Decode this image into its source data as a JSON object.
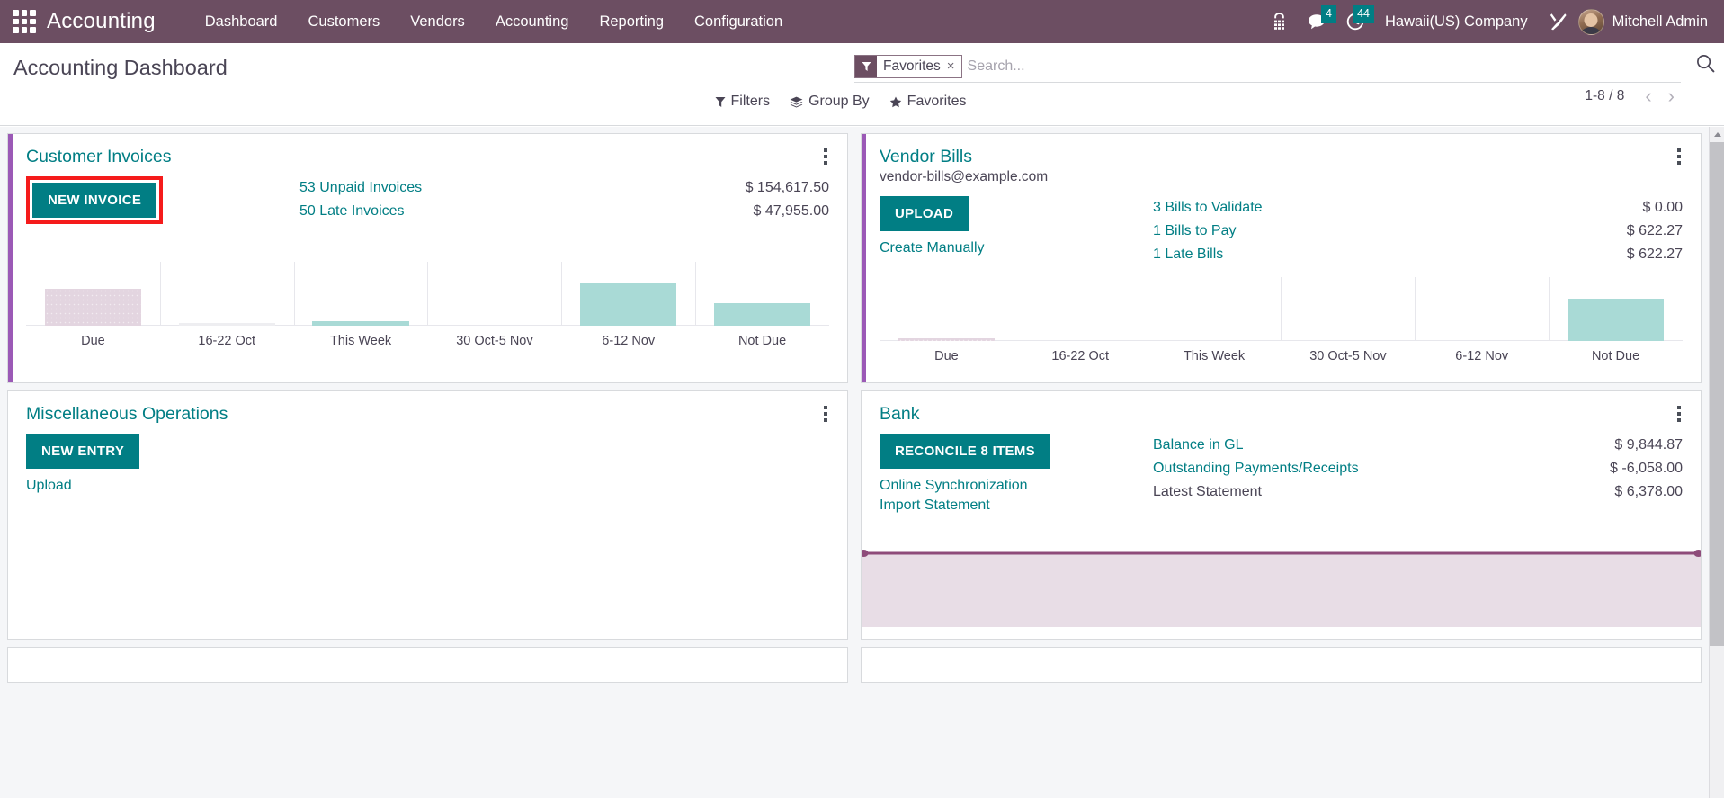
{
  "navbar": {
    "apps_icon": "apps-grid-icon",
    "brand": "Accounting",
    "menu": [
      {
        "label": "Dashboard"
      },
      {
        "label": "Customers"
      },
      {
        "label": "Vendors"
      },
      {
        "label": "Accounting"
      },
      {
        "label": "Reporting"
      },
      {
        "label": "Configuration"
      }
    ],
    "phone_icon": "phone-dialpad-icon",
    "messages_icon": "chat-bubble-icon",
    "messages_count": "4",
    "activities_icon": "clock-icon",
    "activities_count": "44",
    "company": "Hawaii(US) Company",
    "tools_icon": "wrench-screwdriver-icon",
    "avatar_icon": "avatar",
    "user": "Mitchell Admin",
    "badge_color": "#017e84",
    "bg_color": "#6c4e62"
  },
  "control_panel": {
    "title": "Accounting Dashboard",
    "search": {
      "facet_icon": "filter-funnel-icon",
      "facet_label": "Favorites",
      "facet_close": "×",
      "placeholder": "Search...",
      "value": "",
      "magnifier_icon": "search-icon"
    },
    "buttons": [
      {
        "icon": "filter-funnel-icon",
        "glyph": "▼",
        "label": "Filters"
      },
      {
        "icon": "layers-icon",
        "glyph": "◆",
        "label": "Group By"
      },
      {
        "icon": "star-icon",
        "glyph": "★",
        "label": "Favorites"
      }
    ],
    "pager": {
      "range": "1-8 / 8",
      "prev_icon": "chevron-left-icon",
      "prev_glyph": "‹",
      "next_icon": "chevron-right-icon",
      "next_glyph": "›"
    }
  },
  "theme": {
    "accent_purple": "#9b59b6",
    "teal": "#017e84",
    "bar_teal": "#a9dad6",
    "bar_mauve": "#e3d5e0",
    "highlight_red": "#f51b1b"
  },
  "cards": [
    {
      "id": "customer-invoices",
      "title": "Customer Invoices",
      "subtitle": "",
      "primary_button": "NEW INVOICE",
      "primary_highlighted": true,
      "links": [],
      "figures": [
        {
          "label": "53 Unpaid Invoices",
          "value": "$ 154,617.50",
          "muted": false
        },
        {
          "label": "50 Late Invoices",
          "value": "$ 47,955.00",
          "muted": false
        }
      ],
      "chart_ref": 0
    },
    {
      "id": "vendor-bills",
      "title": "Vendor Bills",
      "subtitle": "vendor-bills@example.com",
      "primary_button": "UPLOAD",
      "primary_highlighted": false,
      "links": [
        "Create Manually"
      ],
      "figures": [
        {
          "label": "3 Bills to Validate",
          "value": "$ 0.00",
          "muted": false
        },
        {
          "label": "1 Bills to Pay",
          "value": "$ 622.27",
          "muted": false
        },
        {
          "label": "1 Late Bills",
          "value": "$ 622.27",
          "muted": false
        }
      ],
      "chart_ref": 1
    },
    {
      "id": "miscellaneous-operations",
      "title": "Miscellaneous Operations",
      "subtitle": "",
      "primary_button": "NEW ENTRY",
      "primary_highlighted": false,
      "links": [
        "Upload"
      ],
      "figures": [],
      "chart_ref": null
    },
    {
      "id": "bank",
      "title": "Bank",
      "subtitle": "",
      "primary_button": "RECONCILE 8 ITEMS",
      "primary_highlighted": false,
      "links": [
        "Online Synchronization",
        "Import Statement"
      ],
      "figures": [
        {
          "label": "Balance in GL",
          "value": "$ 9,844.87",
          "muted": false
        },
        {
          "label": "Outstanding Payments/Receipts",
          "value": "$ -6,058.00",
          "muted": false
        },
        {
          "label": "Latest Statement",
          "value": "$ 6,378.00",
          "muted": true
        }
      ],
      "chart_ref": 2
    }
  ],
  "chart_data": [
    {
      "type": "bar",
      "title": "Customer Invoices aged balance",
      "categories": [
        "Due",
        "16-22 Oct",
        "This Week",
        "30 Oct-5 Nov",
        "6-12 Nov",
        "Not Due"
      ],
      "values": [
        42,
        2,
        5,
        0,
        78,
        30
      ],
      "colors": [
        "mauve",
        "gray",
        "teal",
        "teal",
        "teal",
        "teal"
      ],
      "xlabel": "",
      "ylabel": "",
      "ylim": [
        0,
        100
      ],
      "grid": true,
      "legend": false
    },
    {
      "type": "bar",
      "title": "Vendor Bills aged balance",
      "categories": [
        "Due",
        "16-22 Oct",
        "This Week",
        "30 Oct-5 Nov",
        "6-12 Nov",
        "Not Due"
      ],
      "values": [
        2,
        0,
        0,
        0,
        0,
        78
      ],
      "colors": [
        "mauve",
        "teal",
        "teal",
        "teal",
        "teal",
        "teal"
      ],
      "xlabel": "",
      "ylabel": "",
      "ylim": [
        0,
        100
      ],
      "grid": true,
      "legend": false
    },
    {
      "type": "area",
      "title": "Bank balance over time",
      "x": [
        0,
        1,
        2,
        3,
        4,
        5,
        6,
        7,
        8,
        9
      ],
      "values": [
        6378,
        6378,
        6378,
        6378,
        6378,
        6378,
        6378,
        6378,
        6378,
        6378
      ],
      "line_color": "#8e4b7a",
      "fill_color": "#e8dde6",
      "xlabel": "",
      "ylabel": "",
      "grid": false,
      "legend": false
    }
  ],
  "scrollbar": {
    "up_arrow_icon": "scroll-up-arrow-icon"
  }
}
